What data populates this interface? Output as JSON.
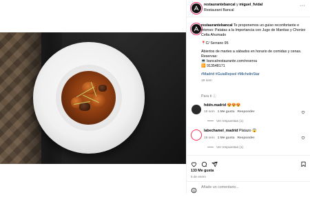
{
  "header": {
    "user1": "restaurantebancal",
    "conjunction": "y",
    "user2": "miguel_fvidal",
    "subtitle": "Restaurant Bancal",
    "more": "···"
  },
  "caption": {
    "username": "restaurantebancal",
    "line1": "Te proponemos un guiso reconfortante e",
    "line2": "intenso: Patatas a la Importancia con Jugo de Manitas y Chorizo",
    "line3": "Celta Ahumado",
    "address": "📍C/ Serrano 95",
    "hours1": "Abiertos de martes a sábados en horario de comidas y cenas.",
    "hours2": "Reservas:",
    "web": "💻 bancalrestaurante.com/reserva",
    "phone": "📴 913548171",
    "hashtags": "#Madrid #GuiaRepsol #MichelinStar",
    "time": "19 sem"
  },
  "para_ti": "Para ti",
  "comments": [
    {
      "username": "hddn.madrid",
      "text": "😍😍😍",
      "time": "19 sem",
      "likes": "1 Me gusta",
      "reply": "Responder",
      "view_replies": "Ver respuestas (1)"
    },
    {
      "username": "labechamel_madrid",
      "text": "Platazo 😱",
      "time": "19 sem",
      "likes": "1 Me gusta",
      "reply": "Responder",
      "view_replies": "Ver respuestas (1)"
    }
  ],
  "footer": {
    "likes_count": "133 Me gusta",
    "date": "5 de enero",
    "comment_placeholder": "Añade un comentario..."
  },
  "icons": {
    "like": "heart-icon",
    "comment": "comment-icon",
    "share": "share-icon",
    "save": "bookmark-icon",
    "emoji": "emoji-icon"
  },
  "colors": {
    "link": "#00376b",
    "muted": "#737373",
    "story_ring": "#e1306c"
  }
}
